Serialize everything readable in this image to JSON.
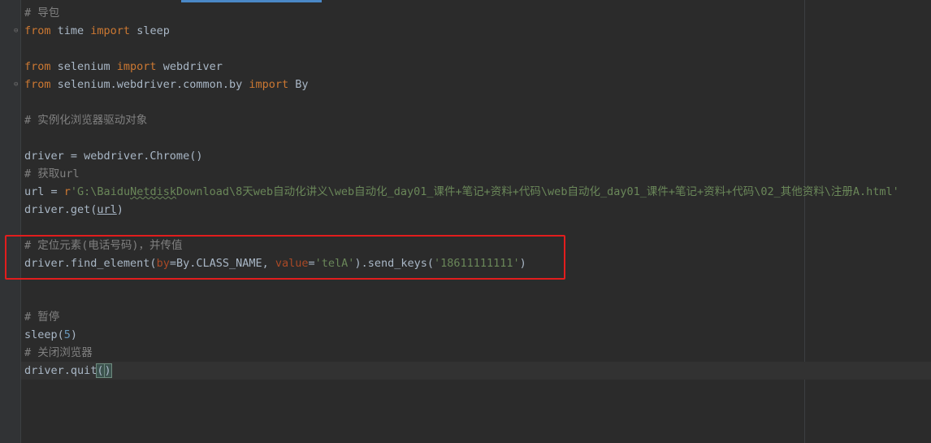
{
  "editor": {
    "lines": [
      {
        "type": "comment",
        "text": "# 导包"
      },
      {
        "type": "import",
        "kw1": "from",
        "mod": " time ",
        "kw2": "import",
        "name": " sleep"
      },
      {
        "type": "blank"
      },
      {
        "type": "import",
        "kw1": "from",
        "mod": " selenium ",
        "kw2": "import",
        "name": " webdriver"
      },
      {
        "type": "import",
        "kw1": "from",
        "mod": " selenium.webdriver.common.by ",
        "kw2": "import",
        "name": " By"
      },
      {
        "type": "blank"
      },
      {
        "type": "comment",
        "text": "# 实例化浏览器驱动对象"
      },
      {
        "type": "blank"
      },
      {
        "type": "plain",
        "text": "driver = webdriver.Chrome()"
      },
      {
        "type": "comment",
        "text": "# 获取url"
      },
      {
        "type": "url_assign",
        "lhs": "url = ",
        "prefix": "r",
        "str_start": "'G:\\Baidu",
        "str_squig": "Netdisk",
        "str_rest": "Download\\8天web自动化讲义\\web自动化_day01_课件+笔记+资料+代码\\web自动化_day01_课件+笔记+资料+代码\\02_其他资料\\注册A.html'"
      },
      {
        "type": "get_call",
        "pre": "driver.get(",
        "arg": "url",
        "post": ")"
      },
      {
        "type": "blank"
      },
      {
        "type": "comment",
        "text": "# 定位元素(电话号码)，并传值"
      },
      {
        "type": "find_call",
        "p1": "driver.find_element(",
        "k1": "by",
        "p2": "=By.CLASS_NAME, ",
        "k2": "value",
        "p3": "=",
        "s1": "'telA'",
        "p4": ").send_keys(",
        "s2": "'18611111111'",
        "p5": ")"
      },
      {
        "type": "blank"
      },
      {
        "type": "blank"
      },
      {
        "type": "comment",
        "text": "# 暂停"
      },
      {
        "type": "sleep_call",
        "pre": "sleep(",
        "num": "5",
        "post": ")"
      },
      {
        "type": "comment",
        "text": "# 关闭浏览器"
      },
      {
        "type": "quit_call",
        "pre": "driver.quit",
        "open": "(",
        "close": ")"
      }
    ]
  }
}
